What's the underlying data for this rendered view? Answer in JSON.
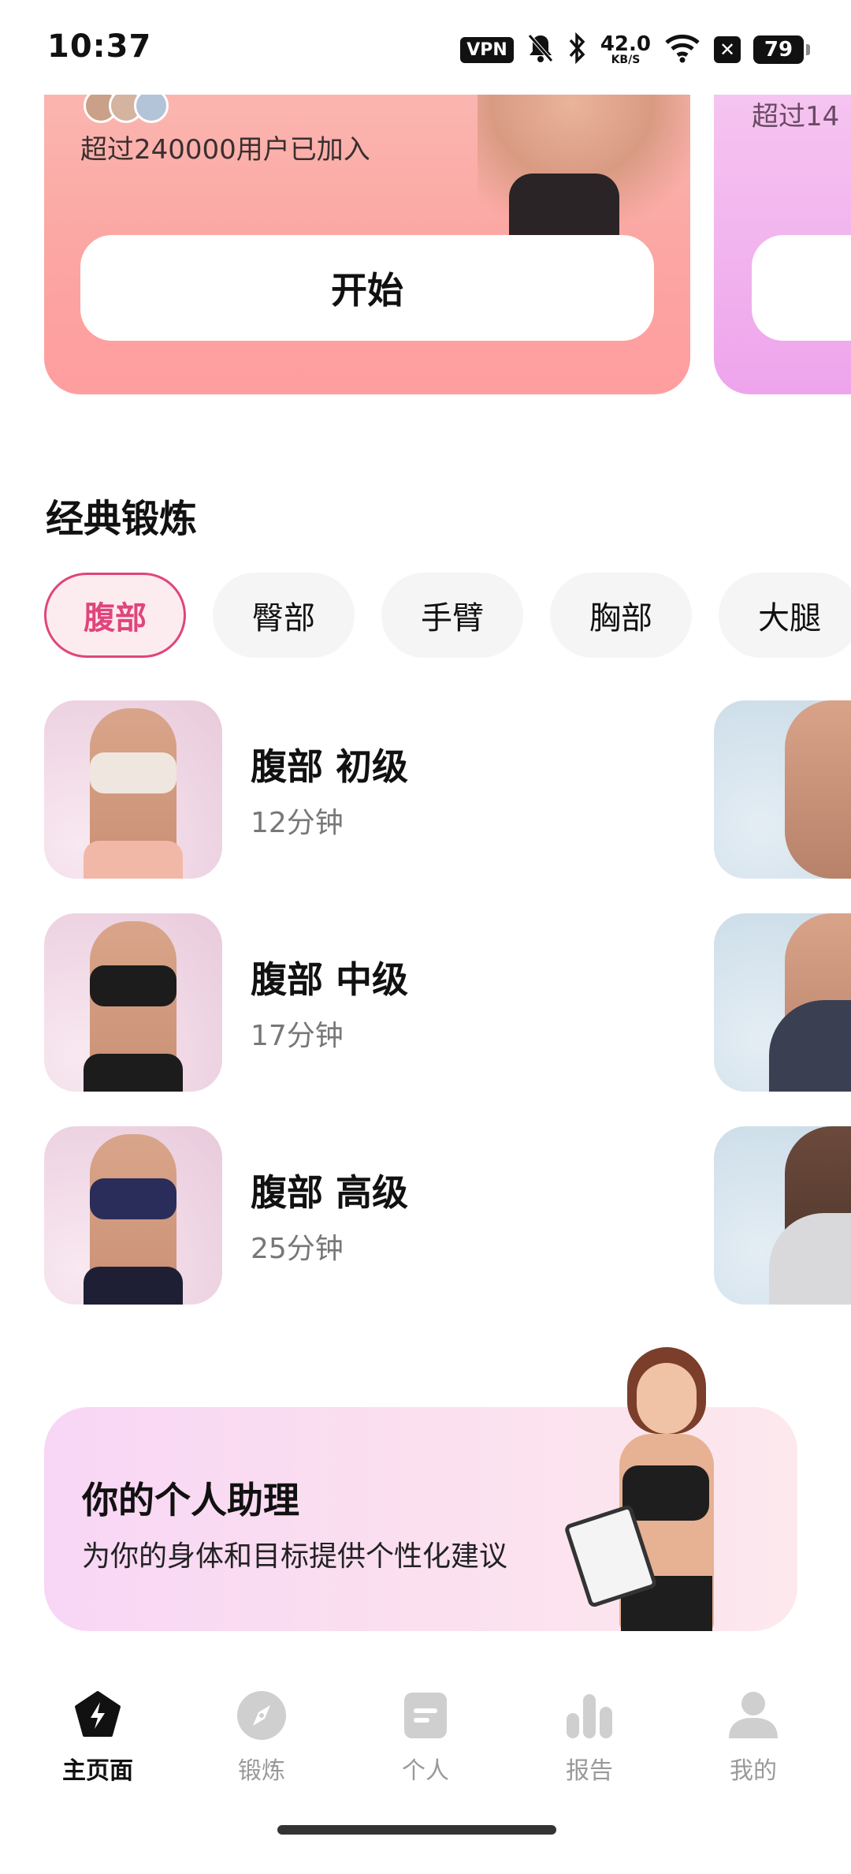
{
  "status_bar": {
    "time": "10:37",
    "vpn": "VPN",
    "speed_value": "42.0",
    "speed_unit": "KB/S",
    "battery": "79"
  },
  "hero": {
    "users_joined": "超过240000用户已加入",
    "start_label": "开始",
    "next_card_users": "超过14"
  },
  "section": {
    "title": "经典锻炼"
  },
  "categories": [
    {
      "label": "腹部",
      "active": true
    },
    {
      "label": "臀部",
      "active": false
    },
    {
      "label": "手臂",
      "active": false
    },
    {
      "label": "胸部",
      "active": false
    },
    {
      "label": "大腿",
      "active": false
    }
  ],
  "workouts": [
    {
      "name": "腹部 初级",
      "duration": "12分钟",
      "top_color": "#efe6df",
      "bottom_color": "#f2b8a7"
    },
    {
      "name": "腹部 中级",
      "duration": "17分钟",
      "top_color": "#1c1c1c",
      "bottom_color": "#1c1c1c"
    },
    {
      "name": "腹部 高级",
      "duration": "25分钟",
      "top_color": "#2a2d5a",
      "bottom_color": "#1e1f34"
    }
  ],
  "assistant": {
    "title": "你的个人助理",
    "subtitle": "为你的身体和目标提供个性化建议"
  },
  "bottom_nav": [
    {
      "label": "主页面",
      "icon": "bolt-icon",
      "active": true
    },
    {
      "label": "锻炼",
      "icon": "compass-icon",
      "active": false
    },
    {
      "label": "个人",
      "icon": "note-icon",
      "active": false
    },
    {
      "label": "报告",
      "icon": "bar-chart-icon",
      "active": false
    },
    {
      "label": "我的",
      "icon": "person-icon",
      "active": false
    }
  ],
  "colors": {
    "accent": "#e0457c",
    "hero_gradient_top": "#fbb7b1",
    "hero_gradient_bottom": "#ff9d9f"
  }
}
